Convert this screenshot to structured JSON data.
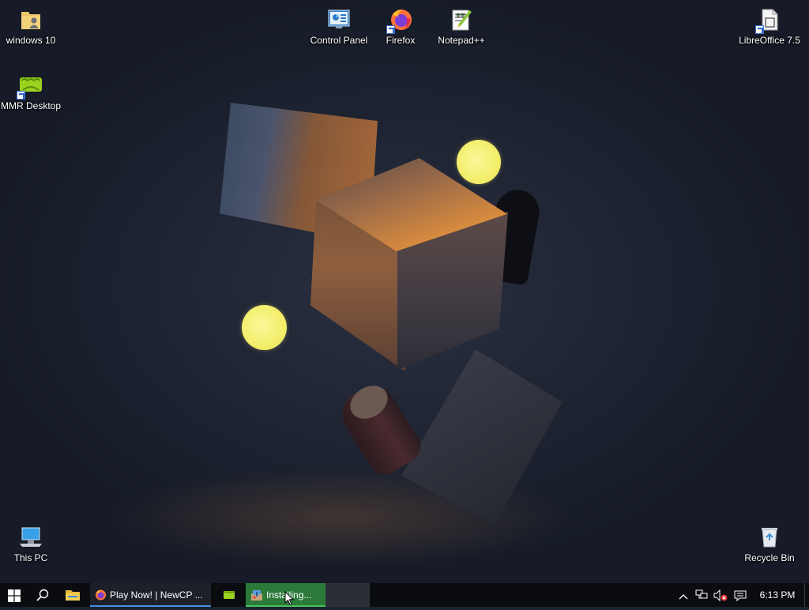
{
  "desktop": {
    "icons": [
      {
        "label": "windows 10",
        "icon": "user-folder-icon"
      },
      {
        "label": "Control Panel",
        "icon": "control-panel-icon"
      },
      {
        "label": "Firefox",
        "icon": "firefox-icon"
      },
      {
        "label": "Notepad++",
        "icon": "notepadpp-icon"
      },
      {
        "label": "LibreOffice 7.5",
        "icon": "libreoffice-icon"
      },
      {
        "label": "MMR Desktop",
        "icon": "mmr-desktop-icon"
      },
      {
        "label": "This PC",
        "icon": "this-pc-icon"
      },
      {
        "label": "Recycle Bin",
        "icon": "recycle-bin-icon"
      }
    ]
  },
  "taskbar": {
    "start_icon": "windows-start-icon",
    "search_icon": "search-icon",
    "file_explorer_icon": "file-explorer-icon",
    "apps": [
      {
        "label": "Play Now! | NewCP ...",
        "icon": "firefox-icon",
        "underline": "#4a8fe8"
      },
      {
        "label": "",
        "icon": "mmr-desktop-icon"
      },
      {
        "label": "Installing...",
        "icon": "installer-icon",
        "accent": "#2c7a3a"
      }
    ],
    "tray": {
      "chevron_icon": "chevron-up-icon",
      "network_icon": "network-icon",
      "volume_icon": "volume-muted-icon",
      "notification_icon": "action-center-icon",
      "time": "6:13 PM"
    }
  },
  "colors": {
    "taskbar_bg": "#0a0c10",
    "orb": "#f3ee6a",
    "active_app_bg": "#2c7a3a"
  }
}
